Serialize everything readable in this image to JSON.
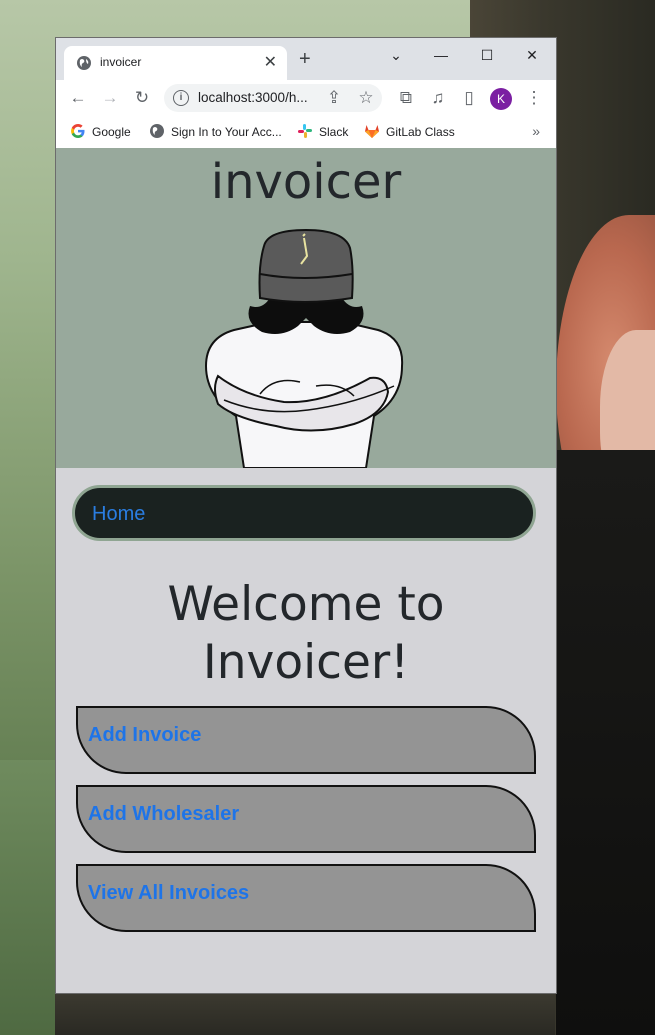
{
  "browser": {
    "tab_title": "invoicer",
    "url": "localhost:3000/h...",
    "avatar_initial": "K",
    "bookmarks": [
      {
        "label": "Google",
        "icon": "google-icon"
      },
      {
        "label": "Sign In to Your Acc...",
        "icon": "globe-icon"
      },
      {
        "label": "Slack",
        "icon": "slack-icon"
      },
      {
        "label": "GitLab Class",
        "icon": "gitlab-icon"
      }
    ]
  },
  "page": {
    "site_title": "invoicer",
    "nav_home": "Home",
    "welcome_line1": "Welcome to",
    "welcome_line2": "Invoicer!",
    "buttons": [
      {
        "label": "Add Invoice"
      },
      {
        "label": "Add Wholesaler"
      },
      {
        "label": "View All Invoices"
      }
    ]
  },
  "colors": {
    "hero_bg": "#98a99c",
    "page_bg": "#d4d4d8",
    "nav_bg": "#1a2220",
    "link": "#1e74e8",
    "button_bg": "#949494"
  }
}
